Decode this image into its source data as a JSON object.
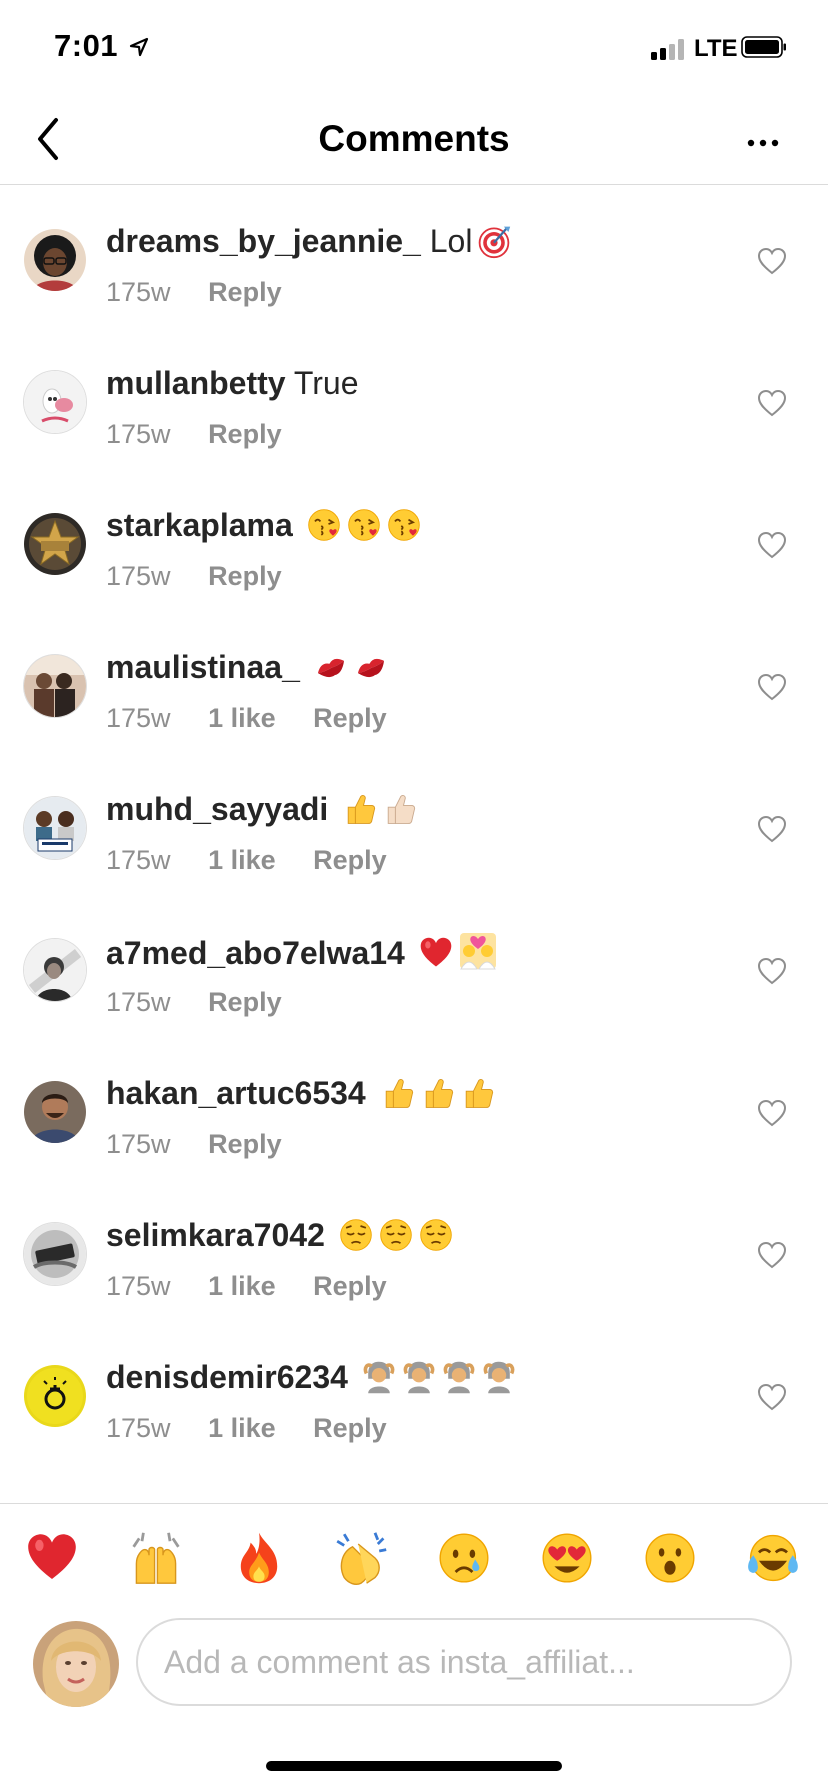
{
  "status_bar": {
    "time": "7:01",
    "network": "LTE"
  },
  "header": {
    "title": "Comments",
    "back_icon": "chevron-left-icon",
    "more_icon": "more-icon"
  },
  "comments": [
    {
      "username": "dreams_by_jeannie_",
      "text": "Lol",
      "emojis": [
        "direct-hit"
      ],
      "age": "175w",
      "likes": "",
      "reply": "Reply"
    },
    {
      "username": "mullanbetty",
      "text": "True",
      "emojis": [],
      "age": "175w",
      "likes": "",
      "reply": "Reply"
    },
    {
      "username": "starkaplama",
      "text": "",
      "emojis": [
        "kissing-face",
        "kissing-face",
        "kissing-face"
      ],
      "age": "175w",
      "likes": "",
      "reply": "Reply"
    },
    {
      "username": "maulistinaa_",
      "text": "",
      "emojis": [
        "kiss-mark",
        "kiss-mark"
      ],
      "age": "175w",
      "likes": "1 like",
      "reply": "Reply"
    },
    {
      "username": "muhd_sayyadi",
      "text": "",
      "emojis": [
        "thumbs-up",
        "thumbs-up-light"
      ],
      "age": "175w",
      "likes": "1 like",
      "reply": "Reply"
    },
    {
      "username": "a7med_abo7elwa14",
      "text": "",
      "emojis": [
        "red-heart",
        "couple-with-heart"
      ],
      "age": "175w",
      "likes": "",
      "reply": "Reply"
    },
    {
      "username": "hakan_artuc6534",
      "text": "",
      "emojis": [
        "thumbs-up",
        "thumbs-up",
        "thumbs-up"
      ],
      "age": "175w",
      "likes": "",
      "reply": "Reply"
    },
    {
      "username": "selimkara7042",
      "text": "",
      "emojis": [
        "pensive-face",
        "pensive-face",
        "pensive-face"
      ],
      "age": "175w",
      "likes": "1 like",
      "reply": "Reply"
    },
    {
      "username": "denisdemir6234",
      "text": "",
      "emojis": [
        "person-gesturing-ok",
        "person-gesturing-ok",
        "person-gesturing-ok",
        "person-gesturing-ok"
      ],
      "age": "175w",
      "likes": "1 like",
      "reply": "Reply"
    }
  ],
  "quick_reactions": [
    "red-heart",
    "raising-hands",
    "fire",
    "clapping-hands",
    "crying-face",
    "heart-eyes",
    "surprised-face",
    "tears-of-joy"
  ],
  "composer": {
    "placeholder": "Add a comment as insta_affiliat..."
  }
}
